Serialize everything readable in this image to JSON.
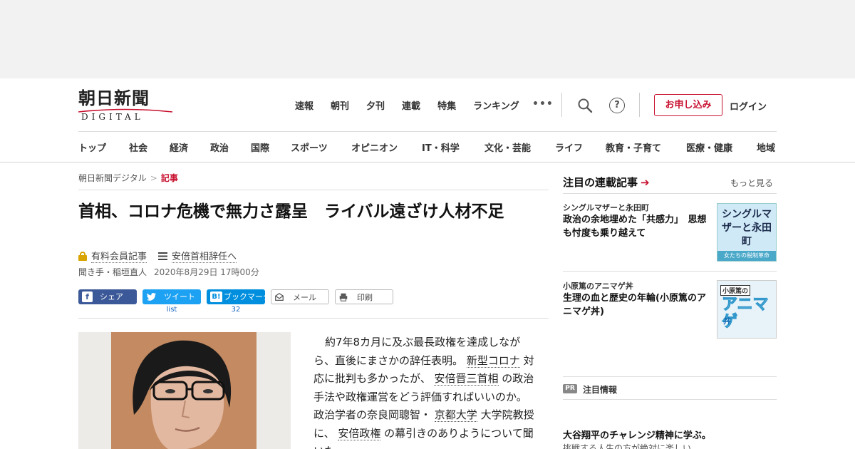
{
  "site": {
    "logo_main": "朝日新聞",
    "logo_sub": "DIGITAL"
  },
  "top_nav": [
    "速報",
    "朝刊",
    "夕刊",
    "連載",
    "特集",
    "ランキング"
  ],
  "more_label": "•••",
  "help_glyph": "?",
  "subscribe_label": "お申し込み",
  "login_label": "ログイン",
  "category_nav": [
    "トップ",
    "社会",
    "経済",
    "政治",
    "国際",
    "スポーツ",
    "オピニオン",
    "IT・科学",
    "文化・芸能",
    "ライフ",
    "教育・子育て",
    "医療・健康",
    "地域"
  ],
  "breadcrumb": {
    "home": "朝日新聞デジタル",
    "separator": ">",
    "current": "記事"
  },
  "article": {
    "headline": "首相、コロナ危機で無力さ露呈　ライバル遠ざけ人材不足",
    "paid_label": "有料会員記事",
    "series_link": "安倍首相辞任へ",
    "byline": "聞き手・稲垣直人",
    "date": "2020年8月29日 17時00分",
    "body": {
      "p1": "約7年8カ月に及ぶ最長政権を達成しながら、直後にまさかの辞任表明。",
      "link1": "新型コロナ",
      "p2": "対応に批判も多かったが、",
      "link2": "安倍晋三首相",
      "p3": "の政治手法や政権運営をどう評価すればいいのか。政治学者の奈良岡聰智・",
      "link3": "京都大学",
      "p4": "大学院教授に、",
      "link4": "安倍政権",
      "p5": "の幕引きのありようについて聞いた。"
    }
  },
  "share": {
    "facebook": "シェア",
    "twitter": "ツイート",
    "twitter_count": "list",
    "hatena_icon": "B!",
    "hatena": "ブックマーク",
    "hatena_count": "32",
    "mail": "メール",
    "print": "印刷"
  },
  "sidebar": {
    "title": "注目の連載記事",
    "arrow": "➔",
    "more": "もっと見る",
    "items": [
      {
        "series": "シングルマザーと永田町",
        "title": "政治の余地埋めた「共感力」　思想も忖度も乗り越えて",
        "thumb_main": "シングルマザーと永田町",
        "thumb_sub": "女たちの税制革命"
      },
      {
        "series": "小原篤のアニマゲ丼",
        "title": "生理の血と歴史の年輪(小原篤のアニマゲ丼)",
        "thumb_label": "小原篤の",
        "thumb_main": "アニマゲ",
        "thumb_sub": "丼"
      }
    ],
    "pr_badge": "PR",
    "pr_title": "注目情報",
    "pr_headline": "大谷翔平のチャレンジ精神に学ぶ。",
    "pr_sub": "挑戦する人生の方が絶対に楽しい"
  },
  "colors": {
    "brand_red": "#c8102e",
    "facebook": "#3b5998",
    "twitter": "#1da1f2",
    "hatena": "#008fde"
  }
}
